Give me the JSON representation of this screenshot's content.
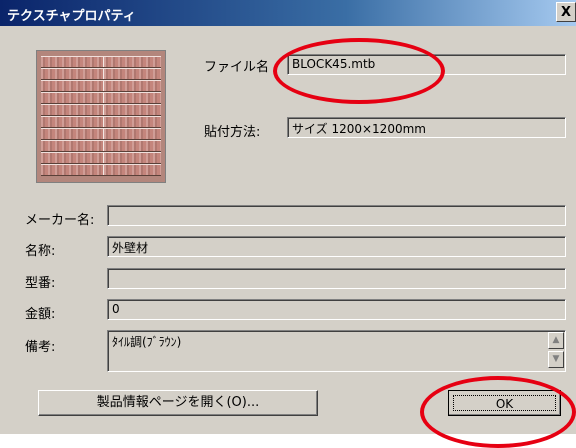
{
  "window": {
    "title": "テクスチャプロパティ",
    "close_glyph": "X"
  },
  "file": {
    "label": "ファイル名",
    "value": "BLOCK45.mtb"
  },
  "paste": {
    "label": "貼付方法:",
    "value": "サイズ 1200×1200mm"
  },
  "form": {
    "maker_label": "メーカー名:",
    "maker_value": "",
    "name_label": "名称:",
    "name_value": "外壁材",
    "model_label": "型番:",
    "model_value": "",
    "price_label": "金額:",
    "price_value": "0",
    "note_label": "備考:",
    "note_value": "ﾀｲﾙ調(ﾌﾞﾗｳﾝ)"
  },
  "buttons": {
    "product_page_label": "製品情報ページを開く(O)...",
    "ok_label": "OK"
  },
  "colors": {
    "annotation_circle": "#e60012",
    "dialog_face": "#d4d0c8",
    "title_bar": "#0a246a"
  }
}
